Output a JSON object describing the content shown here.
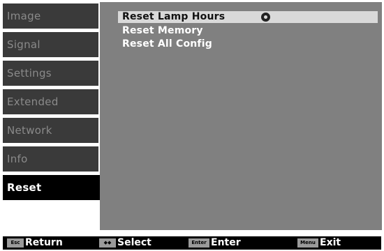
{
  "sidebar": {
    "items": [
      {
        "label": "Image"
      },
      {
        "label": "Signal"
      },
      {
        "label": "Settings"
      },
      {
        "label": "Extended"
      },
      {
        "label": "Network"
      },
      {
        "label": "Info"
      },
      {
        "label": "Reset"
      }
    ],
    "active": "Reset"
  },
  "content": {
    "items": [
      {
        "label": "Reset Lamp Hours"
      },
      {
        "label": "Reset Memory"
      },
      {
        "label": "Reset All Config"
      }
    ],
    "selected": "Reset Lamp Hours",
    "selected_icon": "circle-arrow-icon"
  },
  "footer": {
    "hints": [
      {
        "key": "Esc",
        "label": "Return"
      },
      {
        "key": "◆◆",
        "label": "Select"
      },
      {
        "key": "Enter",
        "label": "Enter"
      },
      {
        "key": "Menu",
        "label": "Exit"
      }
    ]
  },
  "colors": {
    "sidebar_bg": "#3a3a3a",
    "sidebar_active_bg": "#000000",
    "content_bg": "#808080",
    "selected_bg": "#d9d9d9",
    "footer_bg": "#000000"
  }
}
